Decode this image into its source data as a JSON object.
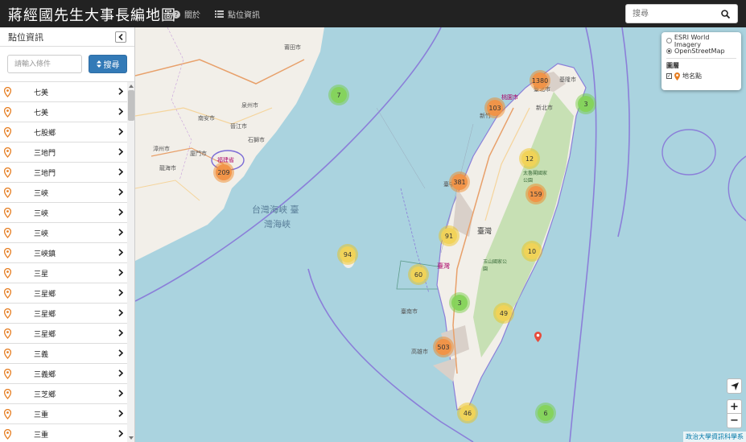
{
  "app": {
    "title": "蔣經國先生大事長編地圖",
    "nav": [
      {
        "label": "關於",
        "icon": "question-circle-icon"
      },
      {
        "label": "點位資訊",
        "icon": "list-icon"
      }
    ],
    "search": {
      "placeholder": "搜尋",
      "icon": "search-icon"
    }
  },
  "sidebar": {
    "title": "點位資訊",
    "collapse_icon": "chevron-left-icon",
    "filter": {
      "placeholder": "請輸入條件",
      "button_label": "搜尋",
      "button_icon": "sort-icon"
    },
    "items": [
      "七美",
      "七美",
      "七股鄉",
      "三地門",
      "三地門",
      "三峽",
      "三峽",
      "三峽",
      "三峽鎮",
      "三星",
      "三星鄉",
      "三星鄉",
      "三星鄉",
      "三義",
      "三義鄉",
      "三芝鄉",
      "三重",
      "三重"
    ]
  },
  "map": {
    "clusters": [
      {
        "label": "1380",
        "level": "orange"
      },
      {
        "label": "103",
        "level": "orange"
      },
      {
        "label": "3",
        "level": "green"
      },
      {
        "label": "7",
        "level": "green"
      },
      {
        "label": "12",
        "level": "yellow"
      },
      {
        "label": "381",
        "level": "orange"
      },
      {
        "label": "159",
        "level": "orange"
      },
      {
        "label": "209",
        "level": "orange"
      },
      {
        "label": "91",
        "level": "yellow"
      },
      {
        "label": "94",
        "level": "yellow"
      },
      {
        "label": "10",
        "level": "yellow"
      },
      {
        "label": "60",
        "level": "yellow"
      },
      {
        "label": "3",
        "level": "green"
      },
      {
        "label": "49",
        "level": "yellow"
      },
      {
        "label": "503",
        "level": "orange"
      },
      {
        "label": "46",
        "level": "yellow"
      },
      {
        "label": "6",
        "level": "green"
      }
    ],
    "place_labels": {
      "putian": "莆田市",
      "quanzhou": "泉州市",
      "xiamen": "廈門市",
      "fujian": "福建省",
      "strait": "台灣海峽 臺",
      "strait2": "灣海峽",
      "taiwan": "臺灣",
      "taipei": "臺北市",
      "keelung": "基隆市",
      "newtaipei": "新北市",
      "taoyuan": "桃園市",
      "hsinchu": "新竹",
      "taichung": "臺中",
      "tainan": "臺南市",
      "kaohsiung": "高雄市",
      "changhua": "臺灣",
      "zhangzhou": "漳州市",
      "jinjiang": "晉江市",
      "nanan": "南安市",
      "shishi": "石獅市",
      "longhai": "龍海市",
      "taroko": "太魯閣國家公園",
      "yushan": "玉山國家公園"
    },
    "colors": {
      "orange": "#f1923c",
      "yellow": "#f1d238",
      "green": "#6ecc39",
      "sea": "#aad3df",
      "land": "#f2efe9"
    },
    "layers": {
      "base": [
        {
          "label": "ESRI World Imagery",
          "selected": false
        },
        {
          "label": "OpenStreetMap",
          "selected": true
        }
      ],
      "overlay_title": "圖層",
      "overlay": [
        {
          "label": "地名點",
          "checked": true,
          "icon": "map-pin-icon"
        }
      ]
    },
    "controls": {
      "locate_icon": "locate-arrow-icon",
      "zoom_in": "+",
      "zoom_out": "−"
    },
    "attribution": "政治大學資訊科學系"
  }
}
